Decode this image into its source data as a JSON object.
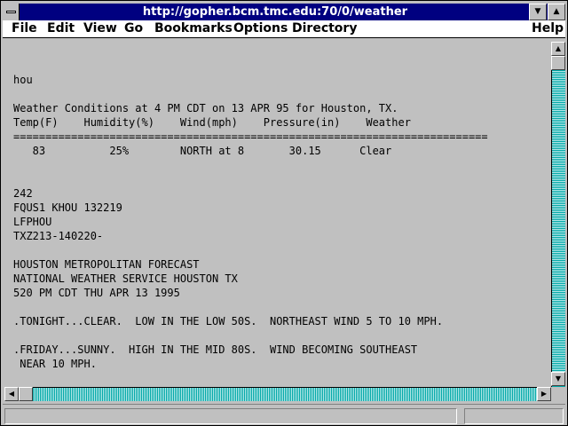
{
  "window": {
    "title": "http://gopher.bcm.tmc.edu:70/0/weather",
    "min_glyph": "▼",
    "max_glyph": "▲"
  },
  "menu": {
    "file": "File",
    "edit": "Edit",
    "view": "View",
    "go": "Go",
    "bookmarks": "Bookmarks",
    "options": "Options",
    "directory": "Directory",
    "help": "Help"
  },
  "document": {
    "lines": [
      "hou",
      "Weather Conditions at 4 PM CDT on 13 APR 95 for Houston, TX.",
      "Temp(F)    Humidity(%)    Wind(mph)    Pressure(in)    Weather",
      "==========================================================================",
      "   83          25%        NORTH at 8       30.15      Clear",
      "242",
      "FQUS1 KHOU 132219",
      "LFPHOU",
      "TXZ213-140220-",
      "HOUSTON METROPOLITAN FORECAST",
      "NATIONAL WEATHER SERVICE HOUSTON TX",
      "520 PM CDT THU APR 13 1995",
      ".TONIGHT...CLEAR.  LOW IN THE LOW 50S.  NORTHEAST WIND 5 TO 10 MPH.",
      ".FRIDAY...SUNNY.  HIGH IN THE MID 80S.  WIND BECOMING SOUTHEAST",
      " NEAR 10 MPH."
    ]
  },
  "scroll": {
    "up": "▲",
    "down": "▼",
    "left": "◀",
    "right": "▶"
  },
  "status": {
    "text": ""
  }
}
